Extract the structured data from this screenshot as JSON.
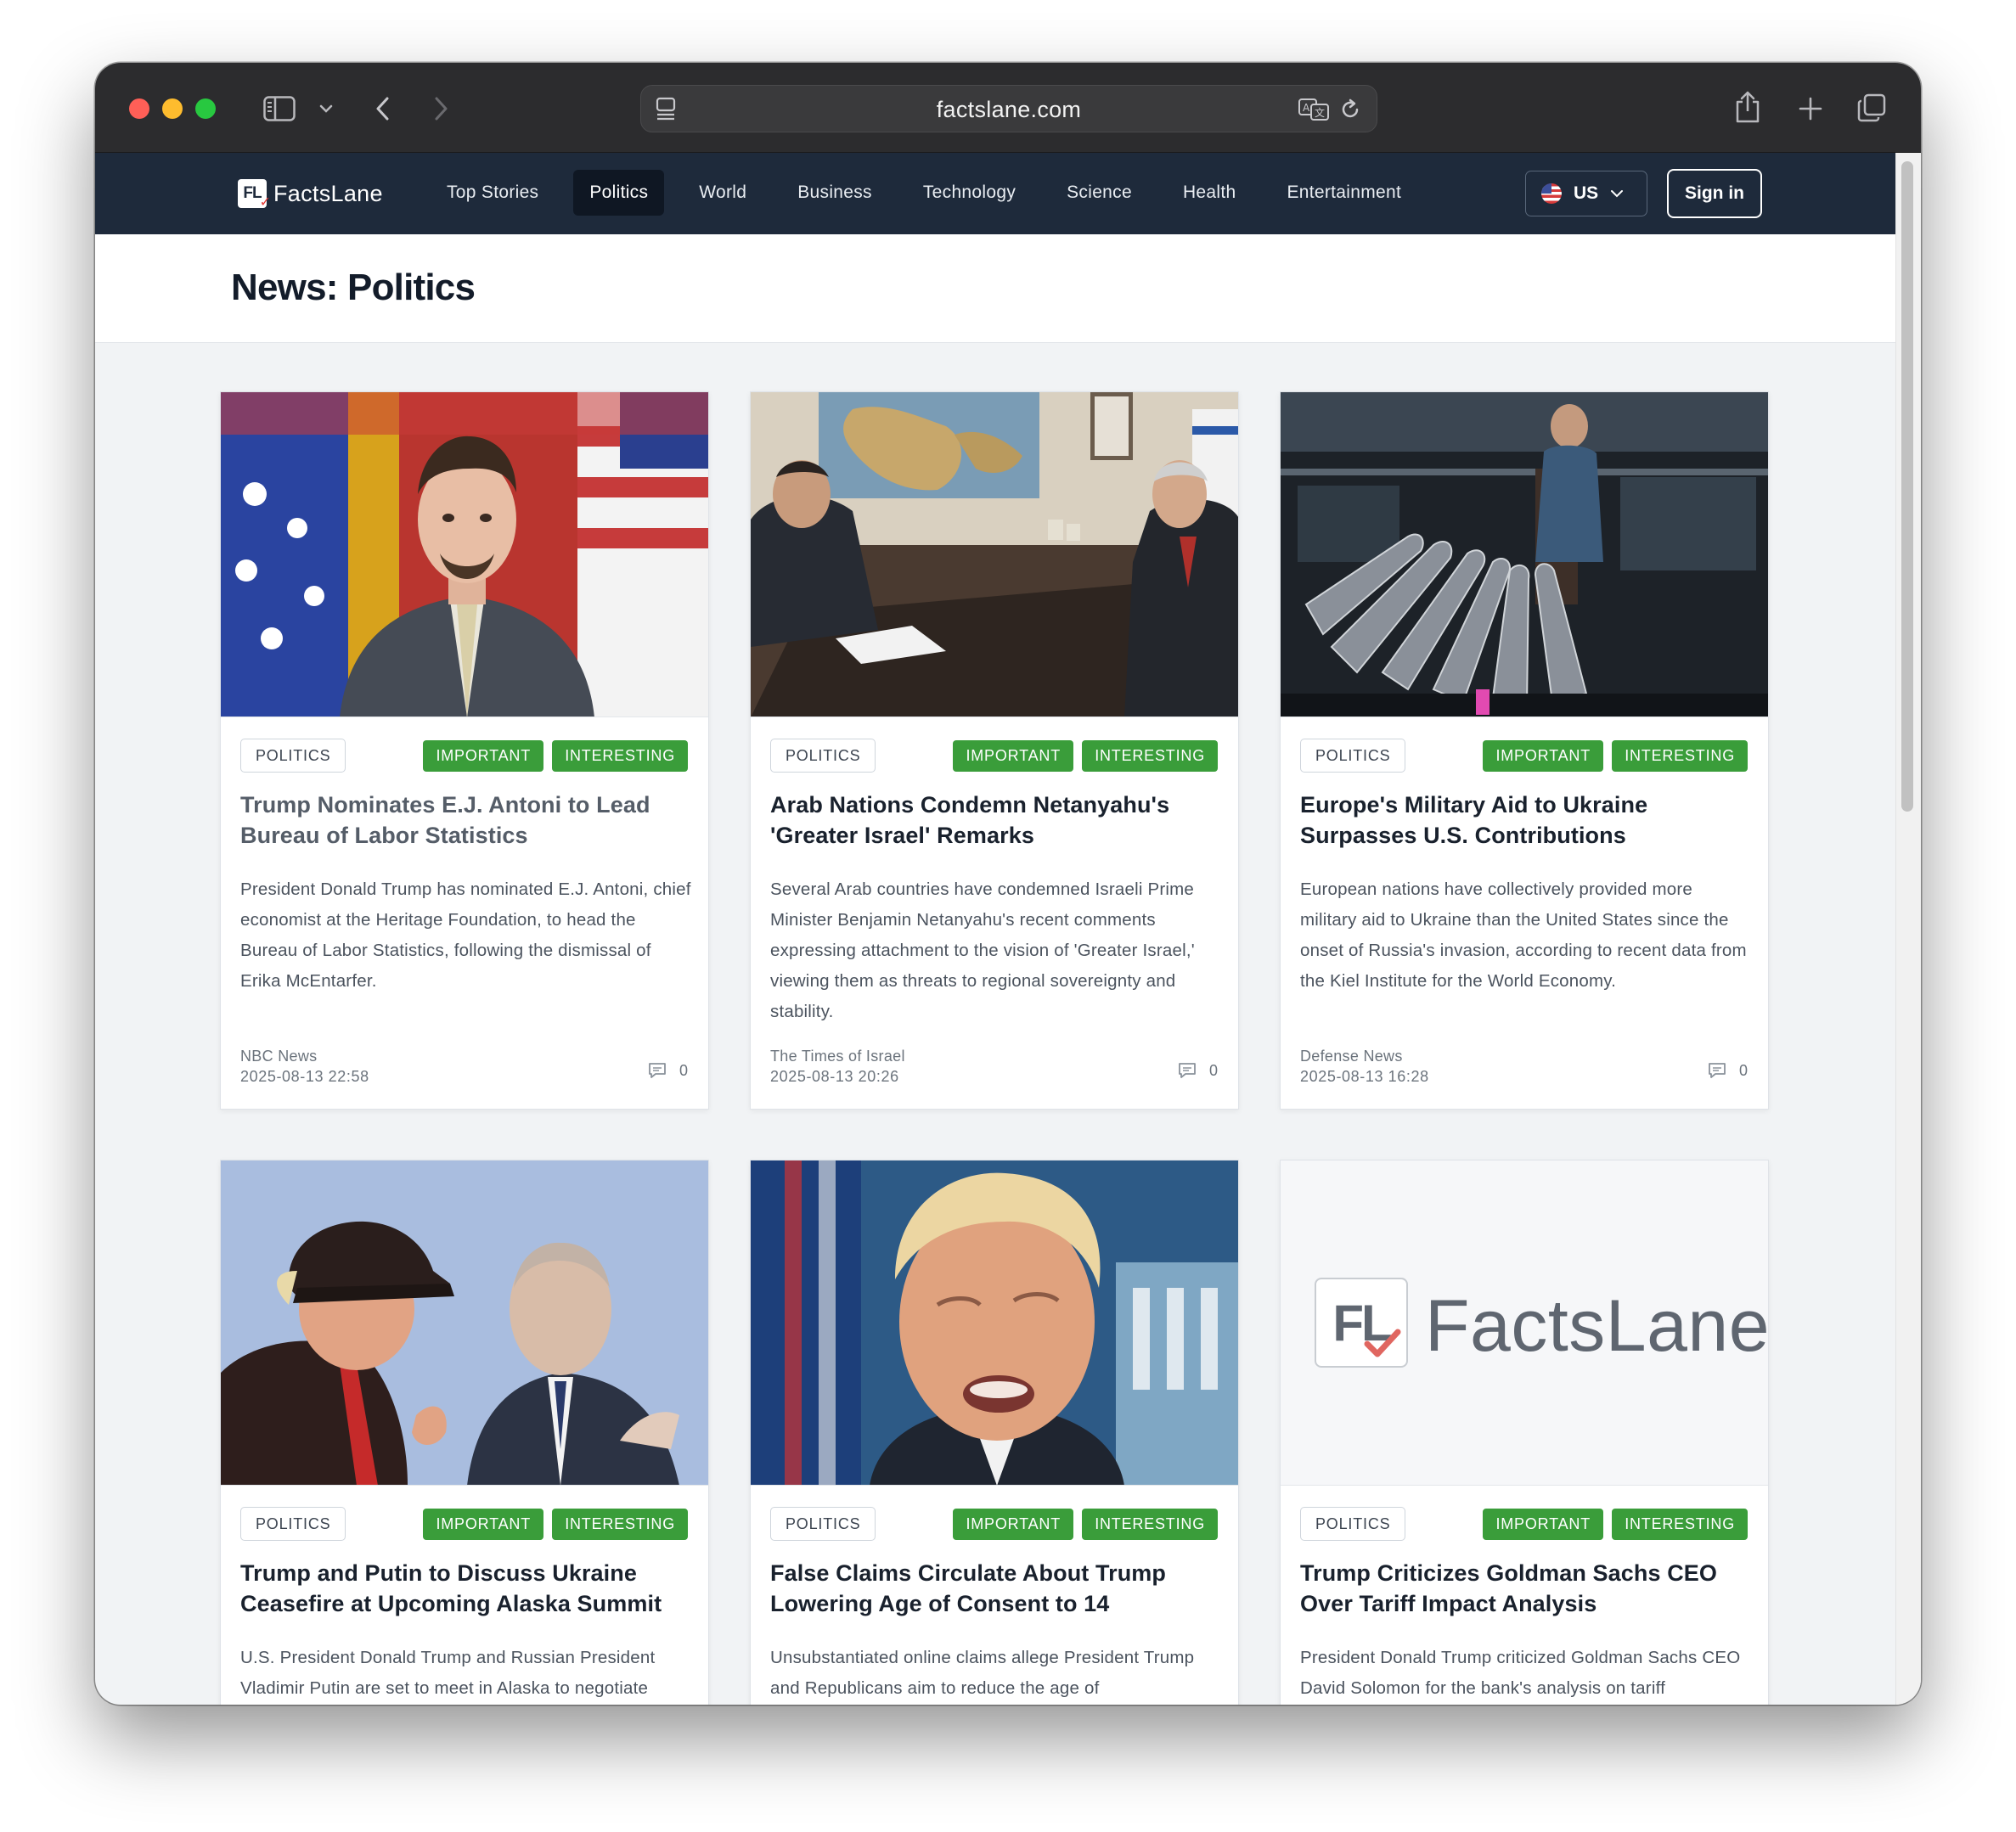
{
  "browser": {
    "url": "factslane.com"
  },
  "site": {
    "logo_mark": "FL",
    "logo_check": "✓",
    "brand": "FactsLane",
    "nav": [
      {
        "label": "Top Stories"
      },
      {
        "label": "Politics",
        "active": true
      },
      {
        "label": "World"
      },
      {
        "label": "Business"
      },
      {
        "label": "Technology"
      },
      {
        "label": "Science"
      },
      {
        "label": "Health"
      },
      {
        "label": "Entertainment"
      }
    ],
    "region": "US",
    "signin": "Sign in"
  },
  "page": {
    "title": "News: Politics"
  },
  "articles": [
    {
      "category": "POLITICS",
      "tag1": "IMPORTANT",
      "tag2": "INTERESTING",
      "headline": "Trump Nominates E.J. Antoni to Lead Bureau of Labor Statistics",
      "summary": "President Donald Trump has nominated E.J. Antoni, chief economist at the Heritage Foundation, to head the Bureau of Labor Statistics, following the dismissal of Erika McEntarfer.",
      "source": "NBC News",
      "date": "2025-08-13 22:58",
      "comments": "0",
      "visited": true
    },
    {
      "category": "POLITICS",
      "tag1": "IMPORTANT",
      "tag2": "INTERESTING",
      "headline": "Arab Nations Condemn Netanyahu's 'Greater Israel' Remarks",
      "summary": "Several Arab countries have condemned Israeli Prime Minister Benjamin Netanyahu's recent comments expressing attachment to the vision of 'Greater Israel,' viewing them as threats to regional sovereignty and stability.",
      "source": "The Times of Israel",
      "date": "2025-08-13 20:26",
      "comments": "0"
    },
    {
      "category": "POLITICS",
      "tag1": "IMPORTANT",
      "tag2": "INTERESTING",
      "headline": "Europe's Military Aid to Ukraine Surpasses U.S. Contributions",
      "summary": "European nations have collectively provided more military aid to Ukraine than the United States since the onset of Russia's invasion, according to recent data from the Kiel Institute for the World Economy.",
      "source": "Defense News",
      "date": "2025-08-13 16:28",
      "comments": "0"
    },
    {
      "category": "POLITICS",
      "tag1": "IMPORTANT",
      "tag2": "INTERESTING",
      "headline": "Trump and Putin to Discuss Ukraine Ceasefire at Upcoming Alaska Summit",
      "summary": "U.S. President Donald Trump and Russian President Vladimir Putin are set to meet in Alaska to negotiate"
    },
    {
      "category": "POLITICS",
      "tag1": "IMPORTANT",
      "tag2": "INTERESTING",
      "headline": "False Claims Circulate About Trump Lowering Age of Consent to 14",
      "summary": "Unsubstantiated online claims allege President Trump and Republicans aim to reduce the age of"
    },
    {
      "category": "POLITICS",
      "tag1": "IMPORTANT",
      "tag2": "INTERESTING",
      "headline": "Trump Criticizes Goldman Sachs CEO Over Tariff Impact Analysis",
      "summary": "President Donald Trump criticized Goldman Sachs CEO David Solomon for the bank's analysis on tariff",
      "placeholder_logo_mark": "FL",
      "placeholder_brand": "FactsLane"
    }
  ]
}
